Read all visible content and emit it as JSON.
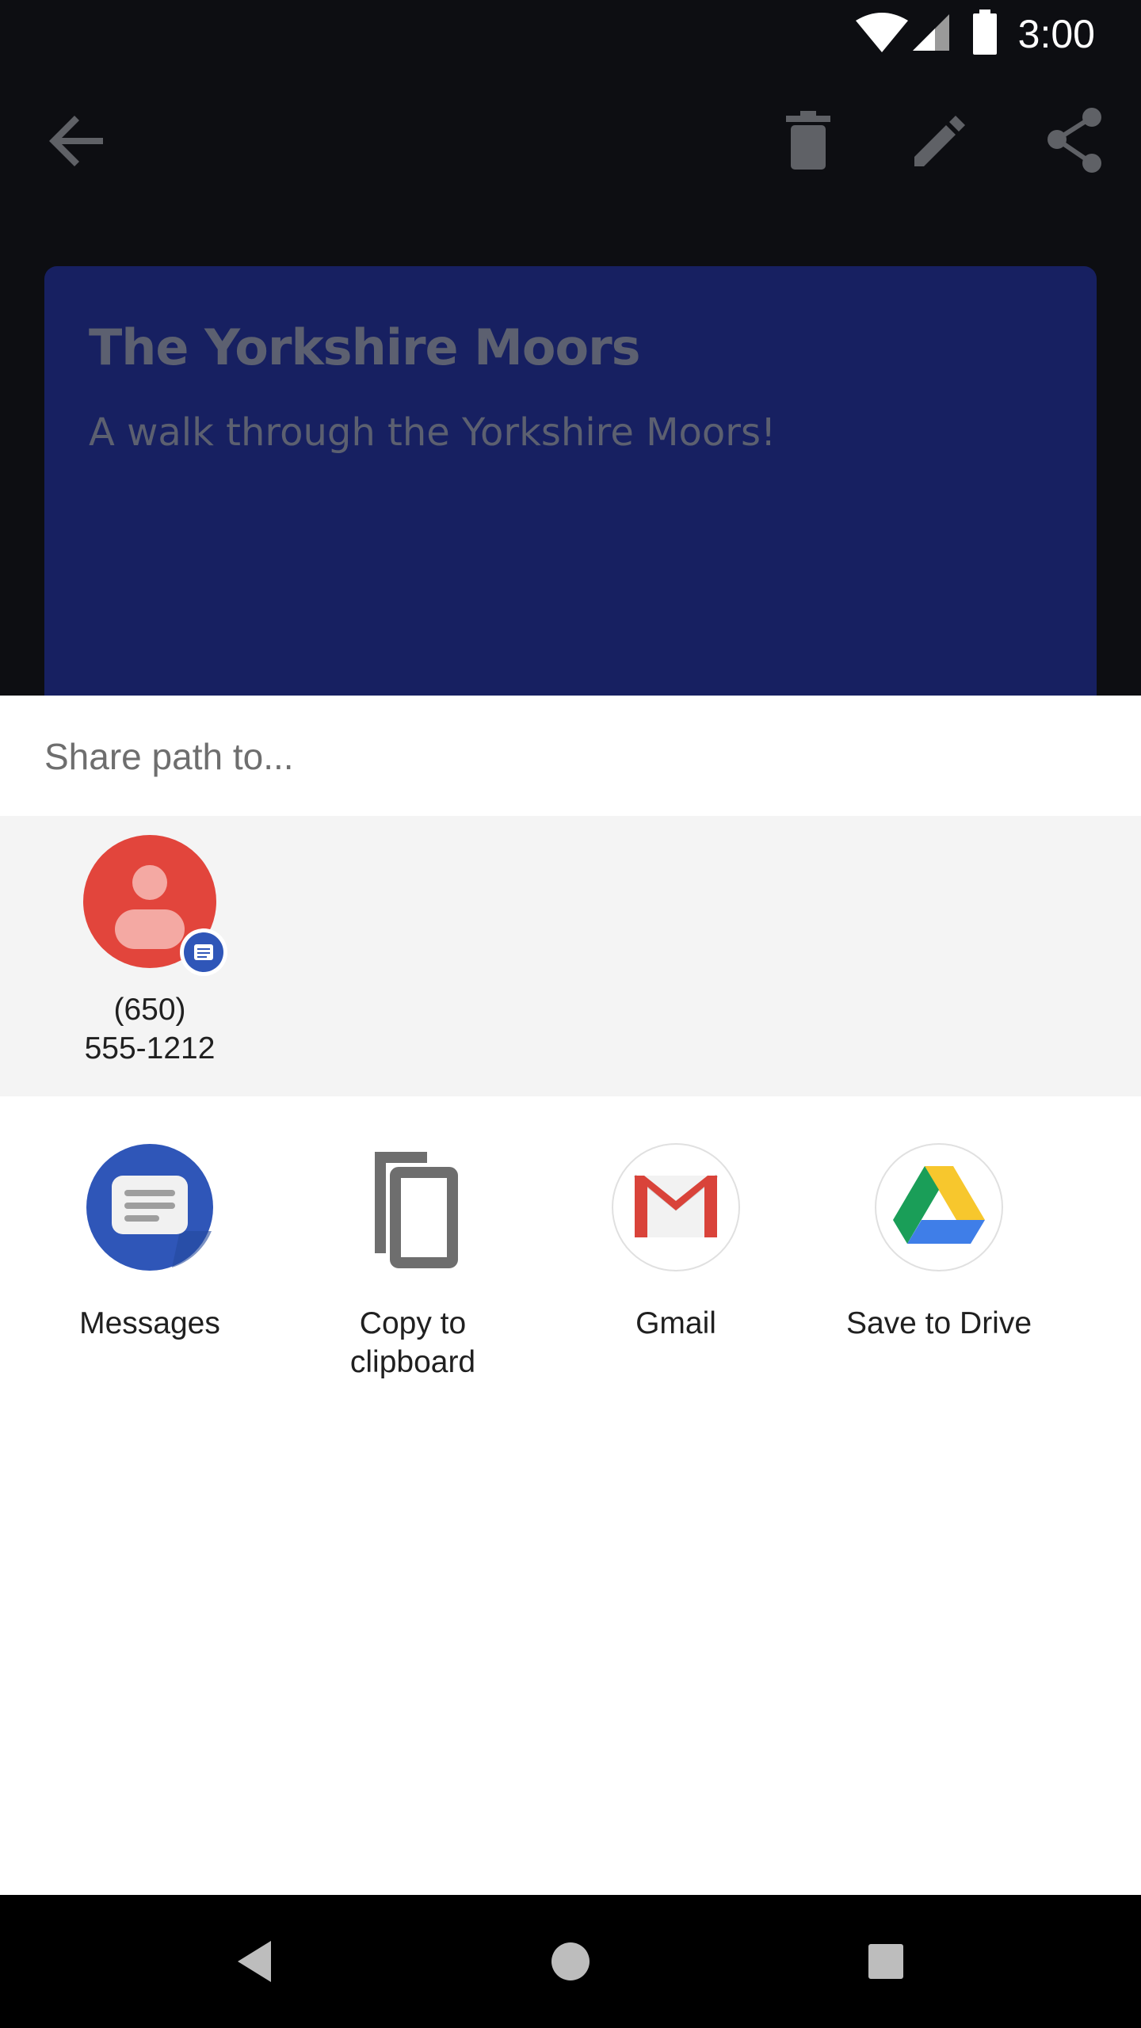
{
  "status_bar": {
    "time": "3:00",
    "icons": [
      "wifi-icon",
      "cell-signal-icon",
      "battery-icon"
    ]
  },
  "toolbar": {
    "icons": [
      "back-arrow-icon",
      "delete-icon",
      "edit-icon",
      "share-icon"
    ]
  },
  "note": {
    "title": "The Yorkshire Moors",
    "description": "A walk through the Yorkshire Moors!"
  },
  "share_sheet": {
    "title": "Share path to...",
    "direct_share": [
      {
        "label": "(650)\n555-1212",
        "icon": "contact-avatar-icon",
        "badge": "messages-badge-icon"
      }
    ],
    "apps": [
      {
        "label": "Messages",
        "icon": "messages-app-icon"
      },
      {
        "label": "Copy to clipboard",
        "icon": "copy-icon"
      },
      {
        "label": "Gmail",
        "icon": "gmail-icon"
      },
      {
        "label": "Save to Drive",
        "icon": "google-drive-icon"
      }
    ]
  },
  "nav_bar": {
    "icons": [
      "nav-back-icon",
      "nav-home-icon",
      "nav-recents-icon"
    ]
  },
  "colors": {
    "app_background": "#0d0e12",
    "card": "#172061",
    "contact_avatar": "#e2453c",
    "messages_blue": "#2f56b8"
  }
}
